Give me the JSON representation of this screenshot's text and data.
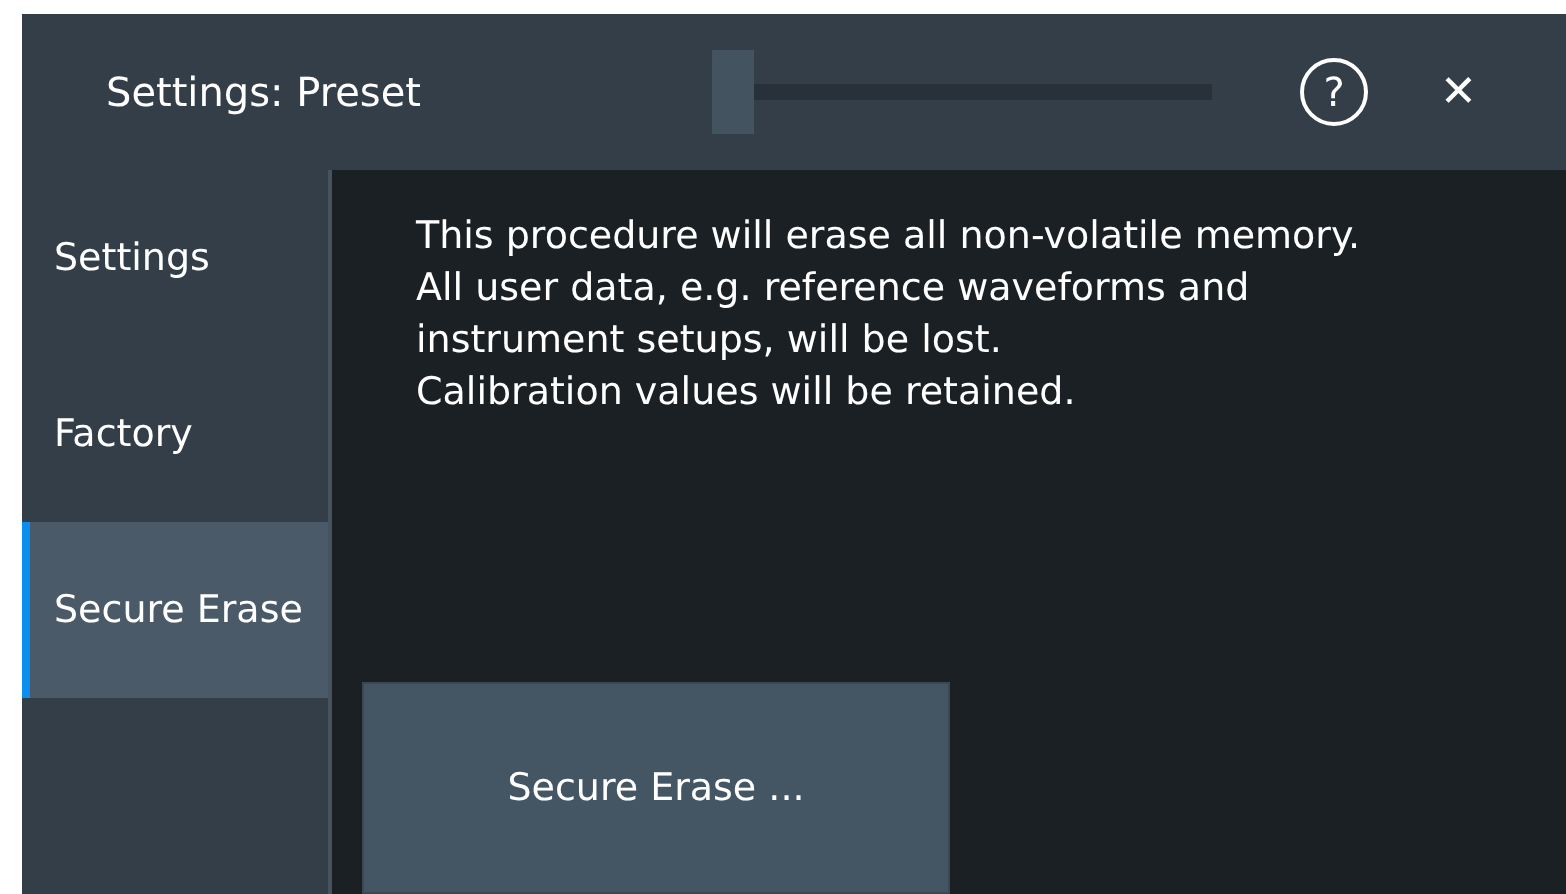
{
  "window": {
    "title": "Settings: Preset"
  },
  "title_slider": {
    "level": 0
  },
  "sidebar": {
    "items": [
      {
        "label": "Settings",
        "selected": false
      },
      {
        "label": "Factory",
        "selected": false
      },
      {
        "label": "Secure Erase",
        "selected": true
      }
    ]
  },
  "content": {
    "lines": [
      "This procedure will erase all non-volatile memory.",
      "All user data, e.g. reference waveforms and",
      "instrument setups, will be lost.",
      "Calibration values will be retained."
    ],
    "button": "Secure Erase ..."
  },
  "help_icon": "?",
  "close_icon": "✕"
}
